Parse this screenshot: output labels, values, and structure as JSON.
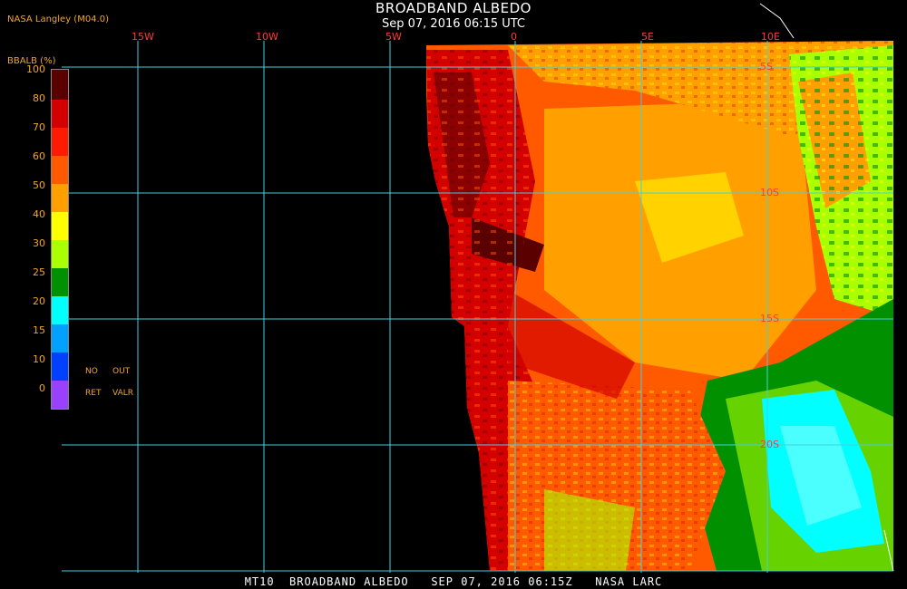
{
  "header": {
    "title": "BROADBAND ALBEDO",
    "datetime": "Sep 07, 2016 06:15 UTC",
    "source": "NASA Langley (M04.0)"
  },
  "colorbar": {
    "unit": "BBALB (%)",
    "labels": [
      "100",
      "80",
      "70",
      "60",
      "50",
      "40",
      "30",
      "25",
      "20",
      "15",
      "10",
      "0"
    ],
    "colors": [
      "#5a0000",
      "#d40000",
      "#ff1a00",
      "#ff5a00",
      "#ffa000",
      "#ffff00",
      "#aaff00",
      "#009000",
      "#00ffff",
      "#00a0ff",
      "#0040ff",
      "#9a40ff"
    ]
  },
  "legend": {
    "no": "NO",
    "out": "OUT",
    "ret": "RET",
    "valr": "VALR"
  },
  "map": {
    "lon_labels": [
      "15W",
      "10W",
      "5W",
      "0",
      "5E",
      "10E"
    ],
    "lat_labels": [
      "5S",
      "10S",
      "15S",
      "20S"
    ]
  },
  "footer": {
    "text": "MT10  BROADBAND ALBEDO   SEP 07, 2016 06:15Z   NASA LARC"
  }
}
